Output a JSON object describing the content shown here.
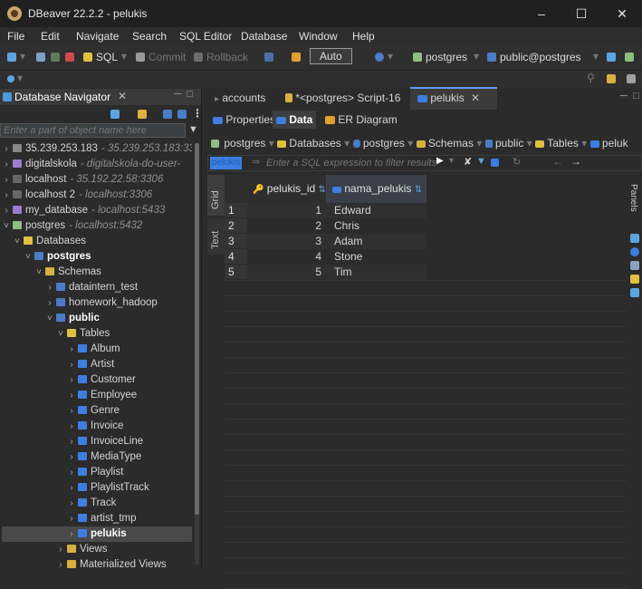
{
  "window": {
    "title": "DBeaver 22.2.2 - pelukis"
  },
  "menubar": {
    "items": [
      "File",
      "Edit",
      "Navigate",
      "Search",
      "SQL Editor",
      "Database",
      "Window",
      "Help"
    ]
  },
  "toolbar": {
    "sql_label": "SQL",
    "commit_label": "Commit",
    "rollback_label": "Rollback",
    "tx_mode": "Auto",
    "connection": "postgres",
    "schema": "public@postgres"
  },
  "navigator": {
    "title": "Database Navigator",
    "filter_placeholder": "Enter a part of object name here",
    "items": [
      {
        "label": "35.239.253.183",
        "sub": "- 35.239.253.183:33"
      },
      {
        "label": "digitalskola",
        "sub": "- digitalskola-do-user-"
      },
      {
        "label": "localhost",
        "sub": "- 35.192.22.58:3306"
      },
      {
        "label": "localhost 2",
        "sub": "- localhost:3306"
      },
      {
        "label": "my_database",
        "sub": "- localhost:5433"
      },
      {
        "label": "postgres",
        "sub": "- localhost:5432"
      },
      {
        "label": "Databases",
        "sub": ""
      },
      {
        "label": "postgres",
        "sub": ""
      },
      {
        "label": "Schemas",
        "sub": ""
      },
      {
        "label": "dataintern_test",
        "sub": ""
      },
      {
        "label": "homework_hadoop",
        "sub": ""
      },
      {
        "label": "public",
        "sub": ""
      },
      {
        "label": "Tables",
        "sub": ""
      },
      {
        "label": "Album",
        "sub": ""
      },
      {
        "label": "Artist",
        "sub": ""
      },
      {
        "label": "Customer",
        "sub": ""
      },
      {
        "label": "Employee",
        "sub": ""
      },
      {
        "label": "Genre",
        "sub": ""
      },
      {
        "label": "Invoice",
        "sub": ""
      },
      {
        "label": "InvoiceLine",
        "sub": ""
      },
      {
        "label": "MediaType",
        "sub": ""
      },
      {
        "label": "Playlist",
        "sub": ""
      },
      {
        "label": "PlaylistTrack",
        "sub": ""
      },
      {
        "label": "Track",
        "sub": ""
      },
      {
        "label": "artist_tmp",
        "sub": ""
      },
      {
        "label": "pelukis",
        "sub": ""
      },
      {
        "label": "Views",
        "sub": ""
      },
      {
        "label": "Materialized Views",
        "sub": ""
      }
    ]
  },
  "editor": {
    "tabs": [
      "accounts",
      "*<postgres> Script-16",
      "pelukis"
    ],
    "subtabs": [
      "Properties",
      "Data",
      "ER Diagram"
    ],
    "breadcrumb": [
      "postgres",
      "Databases",
      "postgres",
      "Schemas",
      "public",
      "Tables",
      "peluk"
    ],
    "filter_table": "pelukis",
    "filter_placeholder": "Enter a SQL expression to filter results (use C",
    "side_tabs": [
      "Grid",
      "Text"
    ],
    "panels_label": "Panels",
    "columns": [
      "pelukis_id",
      "nama_pelukis"
    ],
    "rows": [
      {
        "num": "1",
        "id": "1",
        "name": "Edward"
      },
      {
        "num": "2",
        "id": "2",
        "name": "Chris"
      },
      {
        "num": "3",
        "id": "3",
        "name": "Adam"
      },
      {
        "num": "4",
        "id": "4",
        "name": "Stone"
      },
      {
        "num": "5",
        "id": "5",
        "name": "Tim"
      }
    ]
  },
  "colors": {
    "accent": "#5d9ef3",
    "folder": "#f0c419",
    "table": "#3d7ee0"
  }
}
